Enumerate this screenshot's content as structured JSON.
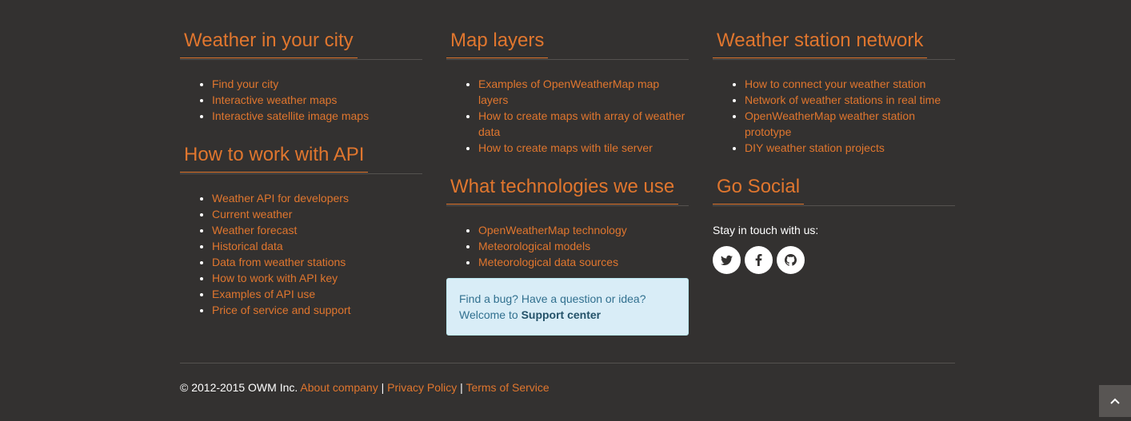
{
  "columns": {
    "weather_city": {
      "title": "Weather in your city",
      "links": [
        "Find your city",
        "Interactive weather maps",
        "Interactive satellite image maps"
      ]
    },
    "api": {
      "title": "How to work with API",
      "links": [
        "Weather API for developers",
        "Current weather",
        "Weather forecast",
        "Historical data",
        "Data from weather stations",
        "How to work with API key",
        "Examples of API use",
        "Price of service and support"
      ]
    },
    "map_layers": {
      "title": "Map layers",
      "links": [
        "Examples of OpenWeatherMap map layers",
        "How to create maps with array of weather data",
        "How to create maps with tile server"
      ]
    },
    "technologies": {
      "title": "What technologies we use",
      "links": [
        "OpenWeatherMap technology",
        "Meteorological models",
        "Meteorological data sources"
      ]
    },
    "stations": {
      "title": "Weather station network",
      "links": [
        "How to connect your weather station",
        "Network of weather stations in real time",
        "OpenWeatherMap weather station prototype",
        "DIY weather station projects"
      ]
    },
    "social": {
      "title": "Go Social",
      "text": "Stay in touch with us:",
      "icons": [
        "twitter-icon",
        "facebook-icon",
        "github-icon"
      ]
    }
  },
  "support": {
    "line1": "Find a bug? Have a question or idea?",
    "prefix": "Welcome to",
    "link": "Support center"
  },
  "footer": {
    "copyright": "© 2012-2015 OWM Inc.",
    "links": [
      "About company",
      "Privacy Policy",
      "Terms of Service"
    ],
    "separator": "|"
  },
  "colors": {
    "background": "#333130",
    "accent": "#e0762e",
    "support_bg": "#d9edf7",
    "support_text": "#31708f"
  }
}
